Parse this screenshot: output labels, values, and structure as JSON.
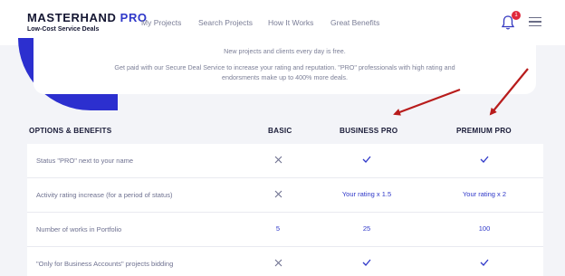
{
  "header": {
    "logo_main": "MASTERHAND",
    "logo_accent": "PRO",
    "logo_sub": "Low-Cost Service Deals",
    "nav": [
      "My Projects",
      "Search Projects",
      "How It Works",
      "Great Benefits"
    ],
    "notifications_count": "1",
    "icons": {
      "bell": "bell-icon",
      "menu": "hamburger-menu-icon"
    }
  },
  "banner": {
    "line1": "New projects and clients every day is free.",
    "line2": "Get paid with our Secure Deal Service to increase your rating and reputation. \"PRO\" professionals with high rating and endorsments make up to 400% more deals."
  },
  "table": {
    "headers": [
      "OPTIONS & BENEFITS",
      "BASIC",
      "BUSINESS PRO",
      "PREMIUM PRO"
    ],
    "rows": [
      {
        "label": "Status \"PRO\" next to your name",
        "basic": "x",
        "business": "check",
        "premium": "check"
      },
      {
        "label": "Activity rating increase (for a period of status)",
        "basic": "x",
        "business": "Your rating x 1.5",
        "premium": "Your rating x 2"
      },
      {
        "label": "Number of works in Portfolio",
        "basic": "5",
        "business": "25",
        "premium": "100"
      },
      {
        "label": "\"Only for Business Accounts\" projects bidding",
        "basic": "x",
        "business": "check",
        "premium": "check"
      }
    ]
  },
  "colors": {
    "accent": "#2f38c9",
    "arrow": "#b81c1c",
    "badge": "#e0283b",
    "background": "#f3f4f8"
  }
}
